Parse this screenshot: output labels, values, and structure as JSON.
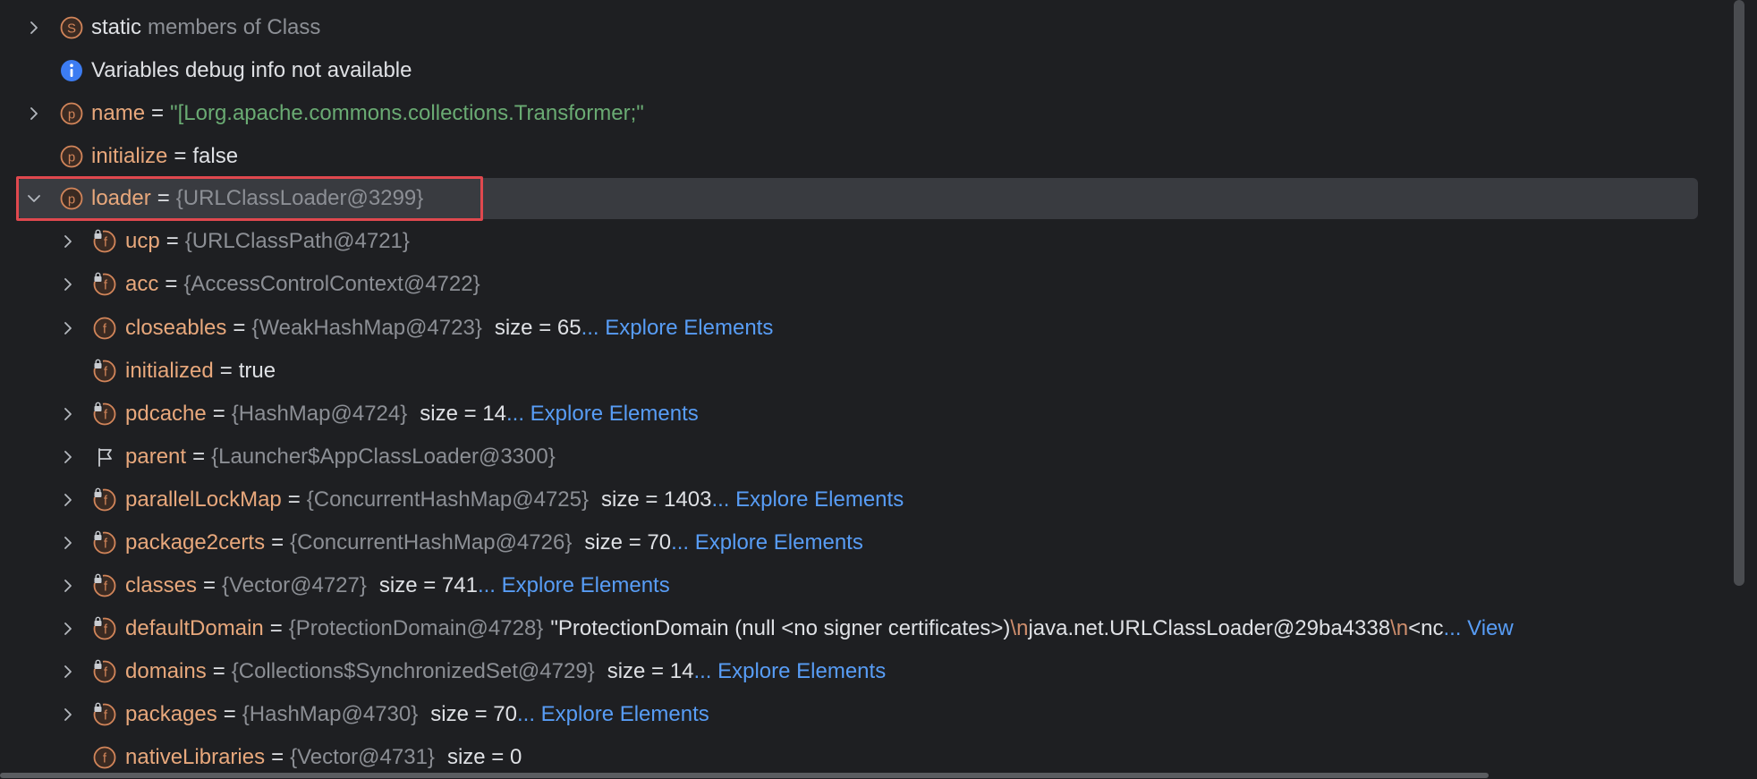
{
  "colors": {
    "background": "#1e1f22",
    "key": "#e8a87c",
    "type": "#8c8f95",
    "string": "#6aab73",
    "link": "#589df6",
    "selection_border": "#e0484e"
  },
  "rows": [
    {
      "icon": "static-icon",
      "key": "static",
      "rest": "members of Class"
    },
    {
      "icon": "info-icon",
      "text": "Variables debug info not available"
    },
    {
      "icon": "property-icon",
      "key": "name",
      "eq": "=",
      "value": "\"[Lorg.apache.commons.collections.Transformer;\""
    },
    {
      "icon": "property-icon",
      "key": "initialize",
      "eq": "=",
      "value": "false"
    },
    {
      "icon": "property-icon",
      "key": "loader",
      "eq": "=",
      "type": "{URLClassLoader@3299}"
    },
    {
      "icon": "field-private-icon",
      "key": "ucp",
      "eq": "=",
      "type": "{URLClassPath@4721}"
    },
    {
      "icon": "field-private-icon",
      "key": "acc",
      "eq": "=",
      "type": "{AccessControlContext@4722}"
    },
    {
      "icon": "field-icon",
      "key": "closeables",
      "eq": "=",
      "type": "{WeakHashMap@4723}",
      "size": "size = 65",
      "link": "... Explore Elements"
    },
    {
      "icon": "field-private-icon",
      "key": "initialized",
      "eq": "=",
      "value": "true"
    },
    {
      "icon": "field-private-icon",
      "key": "pdcache",
      "eq": "=",
      "type": "{HashMap@4724}",
      "size": "size = 14",
      "link": "... Explore Elements"
    },
    {
      "icon": "flag-icon",
      "key": "parent",
      "eq": "=",
      "type": "{Launcher$AppClassLoader@3300}"
    },
    {
      "icon": "field-private-icon",
      "key": "parallelLockMap",
      "eq": "=",
      "type": "{ConcurrentHashMap@4725}",
      "size": "size = 1403",
      "link": "... Explore Elements"
    },
    {
      "icon": "field-private-icon",
      "key": "package2certs",
      "eq": "=",
      "type": "{ConcurrentHashMap@4726}",
      "size": "size = 70",
      "link": "... Explore Elements"
    },
    {
      "icon": "field-private-icon",
      "key": "classes",
      "eq": "=",
      "type": "{Vector@4727}",
      "size": "size = 741",
      "link": "... Explore Elements"
    },
    {
      "icon": "field-private-icon",
      "key": "defaultDomain",
      "eq": "=",
      "type": "{ProtectionDomain@4728}",
      "str1": "\"ProtectionDomain  (null <no signer certificates>)",
      "esc1": "\\n",
      "str2": " java.net.URLClassLoader@29ba4338",
      "esc2": "\\n",
      "str3": " <nc",
      "link": "... View"
    },
    {
      "icon": "field-private-icon",
      "key": "domains",
      "eq": "=",
      "type": "{Collections$SynchronizedSet@4729}",
      "size": "size = 14",
      "link": "... Explore Elements"
    },
    {
      "icon": "field-private-icon",
      "key": "packages",
      "eq": "=",
      "type": "{HashMap@4730}",
      "size": "size = 70",
      "link": "... Explore Elements"
    },
    {
      "icon": "field-icon",
      "key": "nativeLibraries",
      "eq": "=",
      "type": "{Vector@4731}",
      "size": "size = 0"
    }
  ]
}
